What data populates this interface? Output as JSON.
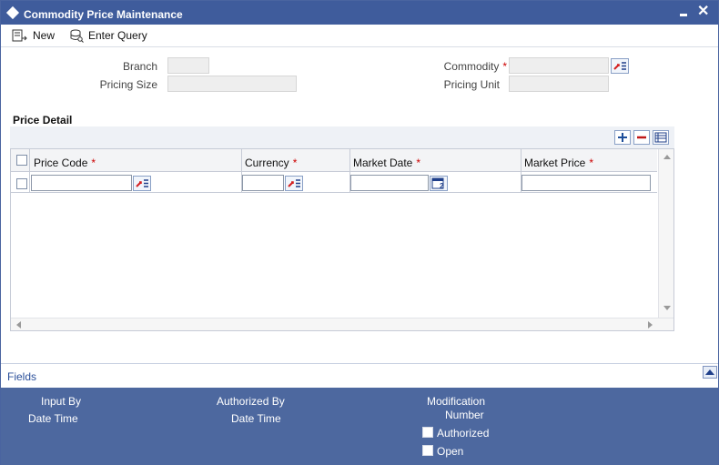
{
  "window": {
    "title": "Commodity Price Maintenance"
  },
  "toolbar": {
    "new_label": "New",
    "enter_query_label": "Enter Query"
  },
  "form": {
    "branch_label": "Branch",
    "pricing_size_label": "Pricing Size",
    "commodity_label": "Commodity",
    "pricing_unit_label": "Pricing Unit",
    "required_mark": "*"
  },
  "price_detail": {
    "title": "Price Detail",
    "columns": [
      {
        "label": "Price Code"
      },
      {
        "label": "Currency"
      },
      {
        "label": "Market Date"
      },
      {
        "label": "Market Price"
      }
    ],
    "rows": [
      {
        "price_code": "",
        "currency": "",
        "market_date": "",
        "market_price": ""
      }
    ]
  },
  "fields_link": "Fields",
  "footer": {
    "input_by": "Input By",
    "date_time_1": "Date Time",
    "authorized_by": "Authorized By",
    "date_time_2": "Date Time",
    "modification": "Modification",
    "number": "Number",
    "authorized": "Authorized",
    "open": "Open"
  },
  "colors": {
    "titlebar": "#3f5c9c",
    "footer": "#4d689f",
    "required": "#cc0000"
  }
}
